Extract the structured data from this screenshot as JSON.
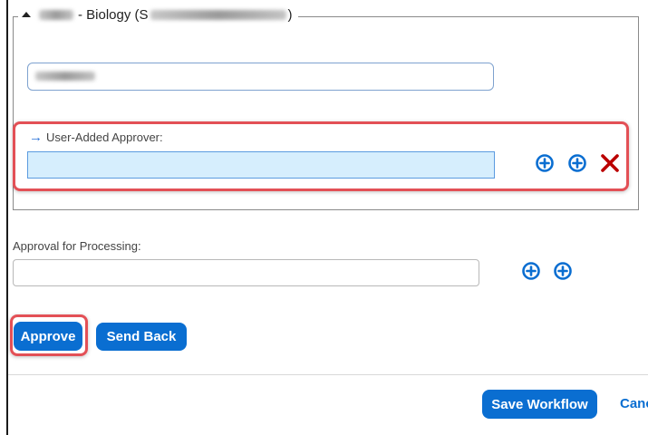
{
  "panel": {
    "legend_code": "",
    "legend_text": " - Biology (S",
    "legend_close": ")",
    "masked_value": ""
  },
  "user_added_approver": {
    "label": "User-Added Approver:",
    "value": ""
  },
  "approval_for_processing": {
    "label": "Approval for Processing:",
    "value": ""
  },
  "actions": {
    "approve": "Approve",
    "send_back": "Send Back",
    "save_workflow": "Save Workflow",
    "cancel": "Canc"
  },
  "icons": {
    "add": "plus-circle-icon",
    "remove": "close-x-icon",
    "arrow": "arrow-right-icon"
  },
  "colors": {
    "accent": "#0a6ed1",
    "highlight_outline": "#e35056",
    "remove_icon": "#bb0000",
    "approver_field_bg": "#d6eefd"
  }
}
